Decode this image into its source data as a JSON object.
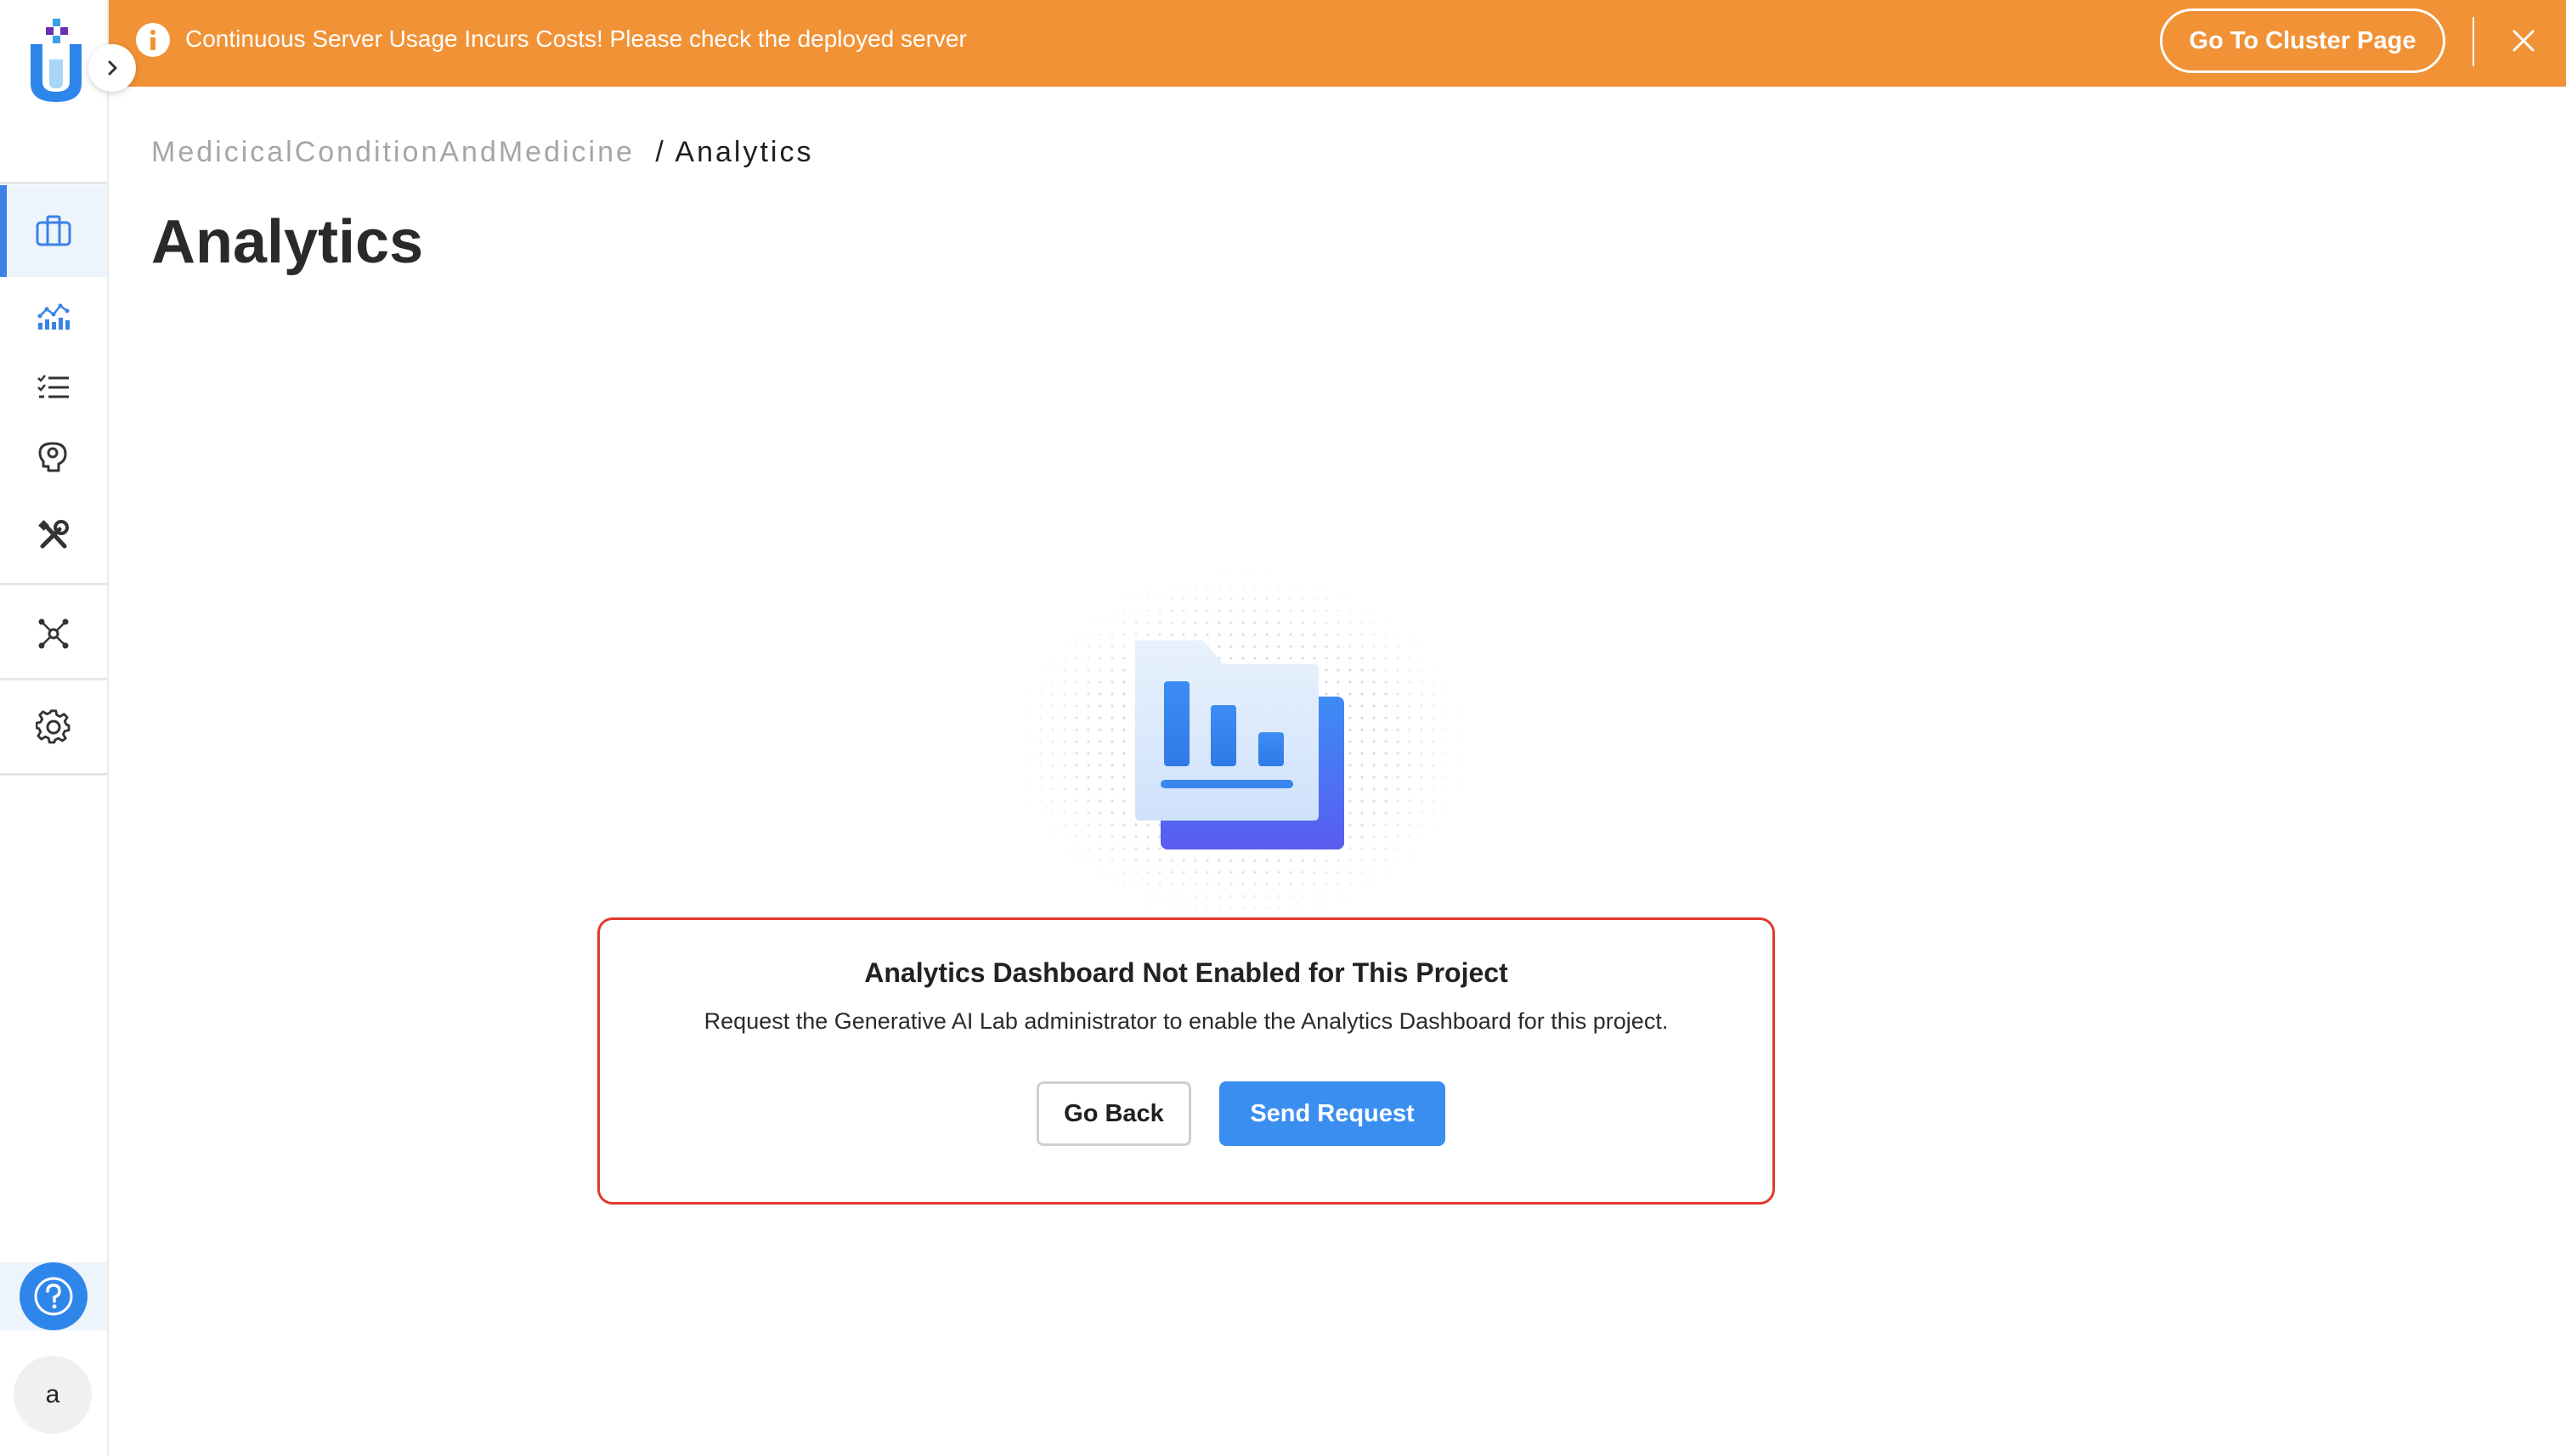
{
  "banner": {
    "message": "Continuous Server Usage Incurs Costs! Please check the deployed server",
    "cluster_button": "Go To Cluster Page",
    "color": "#f29236"
  },
  "sidebar": {
    "items": [
      {
        "name": "projects",
        "icon": "briefcase-icon",
        "active": true
      },
      {
        "name": "analytics",
        "icon": "chart-icon",
        "active": false
      },
      {
        "name": "tasks",
        "icon": "checklist-icon",
        "active": false
      },
      {
        "name": "models",
        "icon": "brain-icon",
        "active": false
      },
      {
        "name": "tools",
        "icon": "tools-icon",
        "active": false
      },
      {
        "name": "integrations",
        "icon": "network-icon",
        "active": false
      },
      {
        "name": "settings",
        "icon": "gear-icon",
        "active": false
      }
    ],
    "help_icon": "help-icon",
    "avatar_letter": "a",
    "accent": "#3b82e6"
  },
  "breadcrumb": {
    "project": "MedicicalConditionAndMedicine",
    "separator": "/",
    "current": "Analytics"
  },
  "page_title": "Analytics",
  "notice": {
    "title": "Analytics Dashboard Not Enabled for This Project",
    "description": "Request the Generative AI Lab administrator to enable the Analytics Dashboard for this project.",
    "back_label": "Go Back",
    "send_label": "Send Request",
    "border_color": "#e0392c"
  }
}
